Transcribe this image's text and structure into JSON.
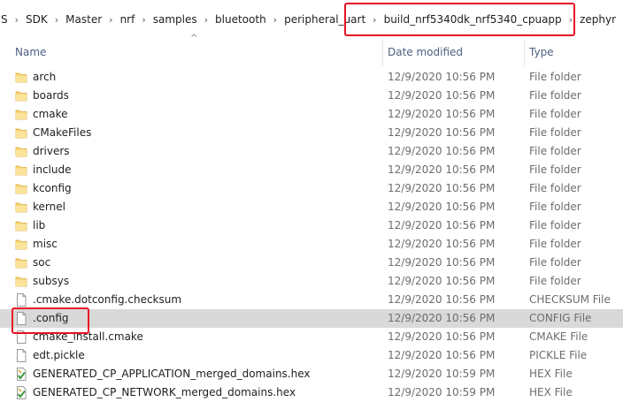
{
  "breadcrumb": [
    "S",
    "SDK",
    "Master",
    "nrf",
    "samples",
    "bluetooth",
    "peripheral_uart",
    "build_nrf5340dk_nrf5340_cpuapp",
    "zephyr"
  ],
  "breadcrumb_separator": "›",
  "columns": {
    "name": "Name",
    "date": "Date modified",
    "type": "Type"
  },
  "files": [
    {
      "name": "arch",
      "date": "12/9/2020 10:56 PM",
      "type": "File folder",
      "icon": "folder-icon"
    },
    {
      "name": "boards",
      "date": "12/9/2020 10:56 PM",
      "type": "File folder",
      "icon": "folder-icon"
    },
    {
      "name": "cmake",
      "date": "12/9/2020 10:56 PM",
      "type": "File folder",
      "icon": "folder-icon"
    },
    {
      "name": "CMakeFiles",
      "date": "12/9/2020 10:56 PM",
      "type": "File folder",
      "icon": "folder-icon"
    },
    {
      "name": "drivers",
      "date": "12/9/2020 10:56 PM",
      "type": "File folder",
      "icon": "folder-icon"
    },
    {
      "name": "include",
      "date": "12/9/2020 10:56 PM",
      "type": "File folder",
      "icon": "folder-icon"
    },
    {
      "name": "kconfig",
      "date": "12/9/2020 10:56 PM",
      "type": "File folder",
      "icon": "folder-icon"
    },
    {
      "name": "kernel",
      "date": "12/9/2020 10:56 PM",
      "type": "File folder",
      "icon": "folder-icon"
    },
    {
      "name": "lib",
      "date": "12/9/2020 10:56 PM",
      "type": "File folder",
      "icon": "folder-icon"
    },
    {
      "name": "misc",
      "date": "12/9/2020 10:56 PM",
      "type": "File folder",
      "icon": "folder-icon"
    },
    {
      "name": "soc",
      "date": "12/9/2020 10:56 PM",
      "type": "File folder",
      "icon": "folder-icon"
    },
    {
      "name": "subsys",
      "date": "12/9/2020 10:56 PM",
      "type": "File folder",
      "icon": "folder-icon"
    },
    {
      "name": ".cmake.dotconfig.checksum",
      "date": "12/9/2020 10:56 PM",
      "type": "CHECKSUM File",
      "icon": "file-icon"
    },
    {
      "name": ".config",
      "date": "12/9/2020 10:56 PM",
      "type": "CONFIG File",
      "icon": "file-icon",
      "selected": true
    },
    {
      "name": "cmake_install.cmake",
      "date": "12/9/2020 10:56 PM",
      "type": "CMAKE File",
      "icon": "file-icon"
    },
    {
      "name": "edt.pickle",
      "date": "12/9/2020 10:56 PM",
      "type": "PICKLE File",
      "icon": "file-icon"
    },
    {
      "name": "GENERATED_CP_APPLICATION_merged_domains.hex",
      "date": "12/9/2020 10:59 PM",
      "type": "HEX File",
      "icon": "hex-file-icon"
    },
    {
      "name": "GENERATED_CP_NETWORK_merged_domains.hex",
      "date": "12/9/2020 10:59 PM",
      "type": "HEX File",
      "icon": "hex-file-icon"
    }
  ],
  "colors": {
    "highlight": "#e81123",
    "folder": "#f8d775",
    "selected_row": "#d9d9d9",
    "header_text": "#4d6082"
  }
}
